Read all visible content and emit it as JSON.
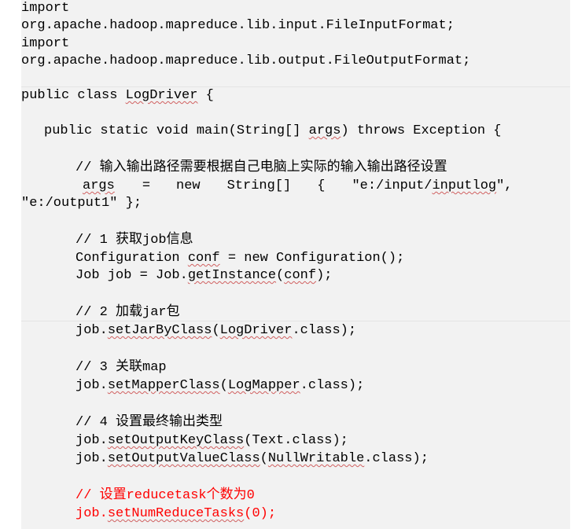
{
  "imports": {
    "import_kw": "import",
    "input_format": "org.apache.hadoop.mapreduce.lib.input.FileInputFormat;",
    "output_format": "org.apache.hadoop.mapreduce.lib.output.FileOutputFormat;"
  },
  "class_decl": {
    "prefix": "public class ",
    "name": "LogDriver",
    "suffix": " {"
  },
  "main_decl": {
    "prefix": "public static void main(String[] ",
    "args": "args",
    "suffix": ") throws Exception {"
  },
  "args_section": {
    "comment": "// 输入输出路径需要根据自己电脑上实际的输入输出路径设置",
    "var": "args",
    "eq": "=",
    "new_kw": "new",
    "type": "String[]",
    "brace": "{",
    "path1_open": "\"e:/input/",
    "path1_word": "inputlog",
    "path1_close": "\",",
    "line2": "\"e:/output1\" };"
  },
  "step1": {
    "comment": "// 1 获取job信息",
    "conf_pre": "Configuration ",
    "conf_var": "conf",
    "conf_post": " = new Configuration();",
    "job_pre": "Job job = Job.",
    "job_method": "getInstance",
    "job_open": "(",
    "job_arg": "conf",
    "job_close": ");"
  },
  "step2": {
    "comment": "// 2 加载jar包",
    "pre": "job.",
    "method": "setJarByClass",
    "open": "(",
    "arg": "LogDriver",
    "close": ".class);"
  },
  "step3": {
    "comment": "// 3 关联map",
    "pre": "job.",
    "method": "setMapperClass",
    "open": "(",
    "arg": "LogMapper",
    "close": ".class);"
  },
  "step4": {
    "comment": "// 4 设置最终输出类型",
    "key_pre": "job.",
    "key_method": "setOutputKeyClass",
    "key_post": "(Text.class);",
    "value_pre": "job.",
    "value_method": "setOutputValueClass",
    "value_open": "(",
    "value_arg": "NullWritable",
    "value_close": ".class);"
  },
  "step5": {
    "comment": "// 设置reducetask个数为0",
    "pre": "job.",
    "method": "setNumReduceTasks",
    "post": "(0);"
  },
  "colors": {
    "background": "#f2f2f2",
    "text": "#000000",
    "highlight": "#ff0000",
    "spellcheck_underline": "#d06060"
  }
}
